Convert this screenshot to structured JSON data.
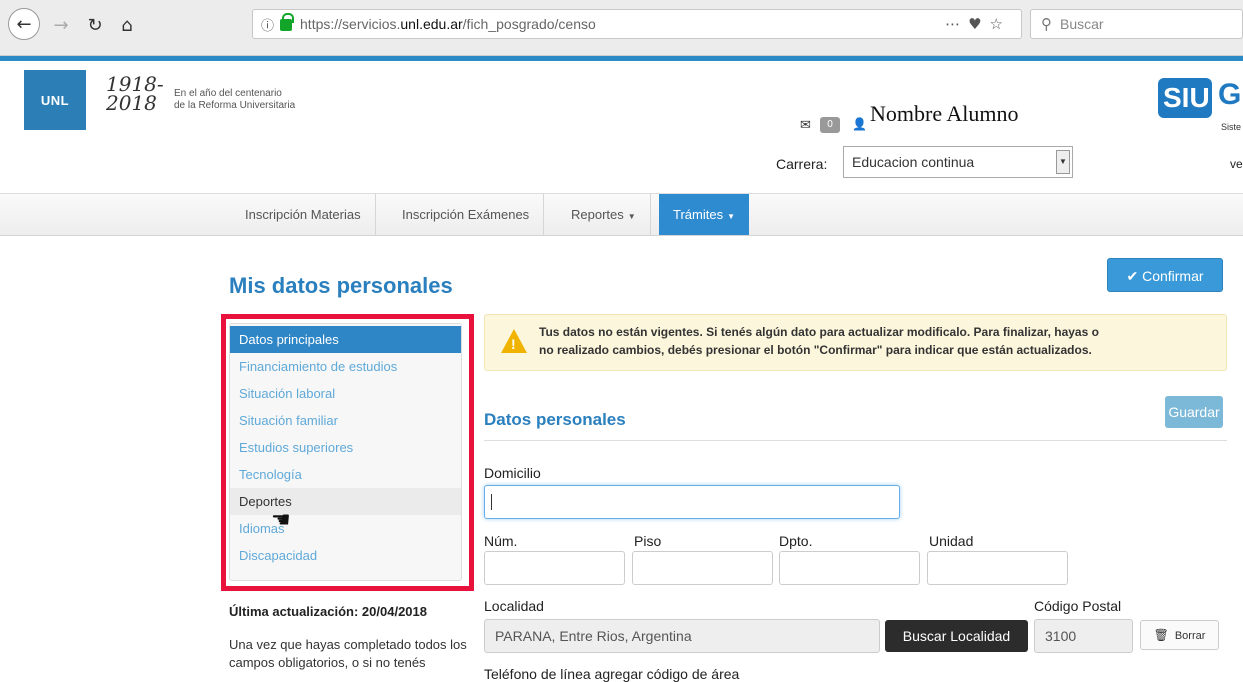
{
  "browser": {
    "url_prefix": "https://servicios.",
    "url_domain": "unl.edu.ar",
    "url_path": "/fich_posgrado/censo",
    "search_placeholder": "Buscar"
  },
  "header": {
    "logo_text": "UNL",
    "years_top": "1918-",
    "years_bottom": "2018",
    "centenario_line1": "En el año del centenario",
    "centenario_line2": "de la Reforma Universitaria",
    "mail_count": "0",
    "user_name": "Nombre Alumno",
    "carrera_label": "Carrera:",
    "carrera_value": "Educacion continua",
    "siu_text": "SIU",
    "siu_g": "G",
    "siu_sub": "Siste",
    "ver_text": "ve"
  },
  "nav": {
    "items": [
      "Inscripción Materias",
      "Inscripción Exámenes",
      "Reportes",
      "Trámites"
    ]
  },
  "page": {
    "title": "Mis datos personales",
    "confirm_label": "Confirmar"
  },
  "sidebar": {
    "items": [
      "Datos principales",
      "Financiamiento de estudios",
      "Situación laboral",
      "Situación familiar",
      "Estudios superiores",
      "Tecnología",
      "Deportes",
      "Idiomas",
      "Discapacidad"
    ]
  },
  "last_update": "Última actualización: 20/04/2018",
  "help_text": "Una vez que hayas completado todos los campos obligatorios, o si no tenés",
  "warning": {
    "line1": "Tus datos no están vigentes. Si tenés algún dato para actualizar modificalo. Para finalizar, hayas o",
    "line2": "no realizado cambios, debés presionar el botón \"Confirmar\" para indicar que están actualizados."
  },
  "form": {
    "section_title": "Datos personales",
    "save_label": "Guardar",
    "domicilio_label": "Domicilio",
    "num_label": "Núm.",
    "piso_label": "Piso",
    "dpto_label": "Dpto.",
    "unidad_label": "Unidad",
    "localidad_label": "Localidad",
    "localidad_value": "PARANA, Entre Rios, Argentina",
    "buscar_label": "Buscar Localidad",
    "cp_label": "Código Postal",
    "cp_value": "3100",
    "borrar_label": "Borrar",
    "telefono_label": "Teléfono de línea agregar código de área"
  }
}
